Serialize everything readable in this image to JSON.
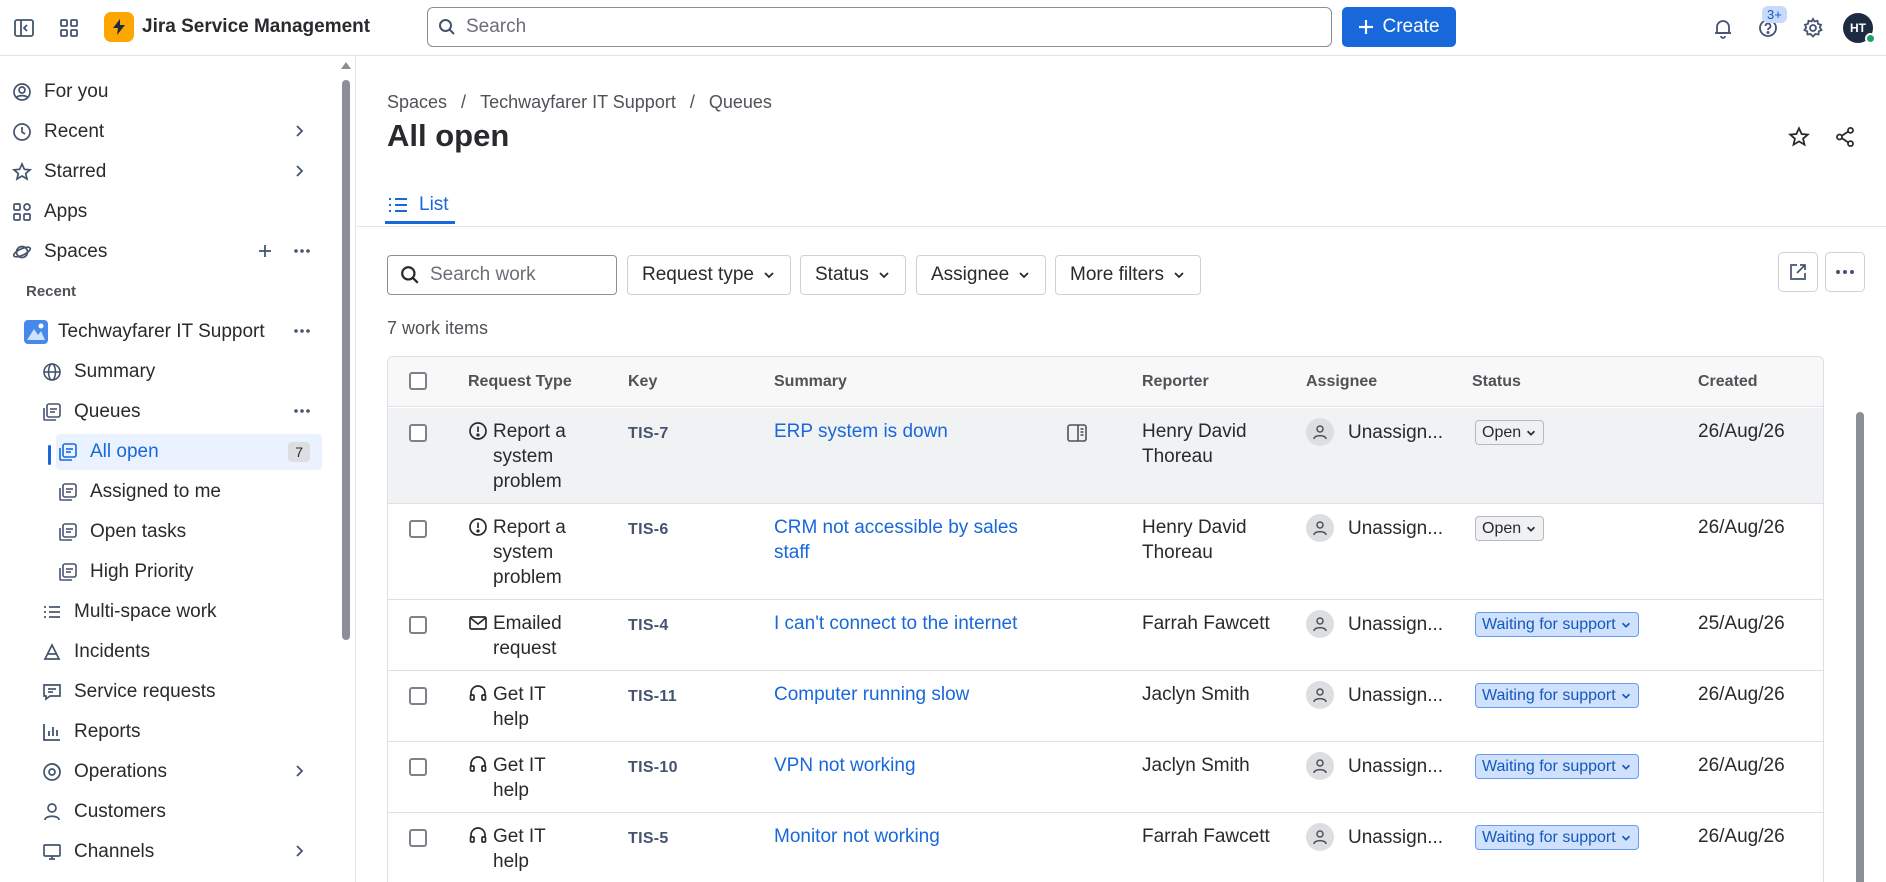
{
  "topbar": {
    "app_title": "Jira Service Management",
    "search_placeholder": "Search",
    "create_label": "Create",
    "notifications_badge": "3+",
    "avatar_initials": "HT"
  },
  "sidebar": {
    "items": [
      {
        "label": "For you",
        "icon": "user-circle-icon"
      },
      {
        "label": "Recent",
        "icon": "clock-icon"
      },
      {
        "label": "Starred",
        "icon": "star-icon"
      },
      {
        "label": "Apps",
        "icon": "apps-icon"
      },
      {
        "label": "Spaces",
        "icon": "planet-icon"
      }
    ],
    "recent_section": "Recent",
    "space_name": "Techwayfarer IT Support",
    "space_items": {
      "summary": "Summary",
      "queues": "Queues",
      "all_open": "All open",
      "all_open_count": "7",
      "assigned_to_me": "Assigned to me",
      "open_tasks": "Open tasks",
      "high_priority": "High Priority",
      "multi_space": "Multi-space work",
      "incidents": "Incidents",
      "service_requests": "Service requests",
      "reports": "Reports",
      "operations": "Operations",
      "customers": "Customers",
      "channels": "Channels"
    }
  },
  "main": {
    "breadcrumb": [
      "Spaces",
      "/",
      "Techwayfarer IT Support",
      "/",
      "Queues"
    ],
    "title": "All open",
    "tab_label": "List",
    "filters": {
      "search_placeholder": "Search work",
      "request_type": "Request type",
      "status": "Status",
      "assignee": "Assignee",
      "more_filters": "More filters"
    },
    "work_count": "7 work items",
    "table": {
      "headers": {
        "request_type": "Request Type",
        "key": "Key",
        "summary": "Summary",
        "reporter": "Reporter",
        "assignee": "Assignee",
        "status": "Status",
        "created": "Created"
      },
      "rows": [
        {
          "request_type": "Report a system problem",
          "rt_icon": "alert-circle-icon",
          "key": "TIS-7",
          "summary": "ERP system is down",
          "reporter": "Henry David Thoreau",
          "assignee": "Unassign...",
          "status": "Open",
          "created": "26/Aug/26"
        },
        {
          "request_type": "Report a system problem",
          "rt_icon": "alert-circle-icon",
          "key": "TIS-6",
          "summary": "CRM not accessible by sales staff",
          "reporter": "Henry David Thoreau",
          "assignee": "Unassign...",
          "status": "Open",
          "created": "26/Aug/26"
        },
        {
          "request_type": "Emailed request",
          "rt_icon": "mail-icon",
          "key": "TIS-4",
          "summary": "I can't connect to the internet",
          "reporter": "Farrah Fawcett",
          "assignee": "Unassign...",
          "status": "Waiting for support",
          "created": "25/Aug/26"
        },
        {
          "request_type": "Get IT help",
          "rt_icon": "headset-icon",
          "key": "TIS-11",
          "summary": "Computer running slow",
          "reporter": "Jaclyn Smith",
          "assignee": "Unassign...",
          "status": "Waiting for support",
          "created": "26/Aug/26"
        },
        {
          "request_type": "Get IT help",
          "rt_icon": "headset-icon",
          "key": "TIS-10",
          "summary": "VPN not working",
          "reporter": "Jaclyn Smith",
          "assignee": "Unassign...",
          "status": "Waiting for support",
          "created": "26/Aug/26"
        },
        {
          "request_type": "Get IT help",
          "rt_icon": "headset-icon",
          "key": "TIS-5",
          "summary": "Monitor not working",
          "reporter": "Farrah Fawcett",
          "assignee": "Unassign...",
          "status": "Waiting for support",
          "created": "26/Aug/26"
        }
      ]
    }
  },
  "colors": {
    "accent": "#1868db",
    "logo": "#fca700",
    "status_wait_bg": "#cfe1fd",
    "status_open_bg": "#f0f1f2"
  }
}
